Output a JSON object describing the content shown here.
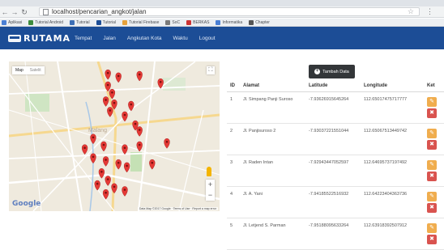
{
  "browser": {
    "url": "localhost/pencarian_angkot/jalan",
    "bookmarks": [
      {
        "label": "Aplikasi",
        "color": "#4a7fd4"
      },
      {
        "label": "Tutorial Android",
        "color": "#3d8b3d"
      },
      {
        "label": "Tutorial",
        "color": "#3d6fb6"
      },
      {
        "label": "Tutorial",
        "color": "#1c4d96"
      },
      {
        "label": "Tutorial Firebase",
        "color": "#e6a23c"
      },
      {
        "label": "SoC",
        "color": "#7a7a7a"
      },
      {
        "label": "BERKAS",
        "color": "#cc3333"
      },
      {
        "label": "Informatika",
        "color": "#4a7fd4"
      },
      {
        "label": "Chapter",
        "color": "#555555"
      }
    ]
  },
  "navbar": {
    "brand": "RUTAMA",
    "items": [
      "Tempat",
      "Jalan",
      "Angkutan Kota",
      "Waktu",
      "Logout"
    ]
  },
  "map": {
    "type_active": "Map",
    "type_inactive": "Satelit",
    "google": "Google",
    "attribution": "Data Map ©2017 Google · Terms of Use · Report a map error",
    "city": "Malang",
    "zoom_in": "+",
    "zoom_out": "−",
    "markers": [
      [
        0.47,
        0.12
      ],
      [
        0.52,
        0.14
      ],
      [
        0.62,
        0.13
      ],
      [
        0.72,
        0.18
      ],
      [
        0.47,
        0.2
      ],
      [
        0.49,
        0.25
      ],
      [
        0.46,
        0.3
      ],
      [
        0.5,
        0.32
      ],
      [
        0.48,
        0.37
      ],
      [
        0.58,
        0.33
      ],
      [
        0.55,
        0.4
      ],
      [
        0.6,
        0.46
      ],
      [
        0.62,
        0.5
      ],
      [
        0.4,
        0.55
      ],
      [
        0.36,
        0.62
      ],
      [
        0.45,
        0.6
      ],
      [
        0.55,
        0.62
      ],
      [
        0.62,
        0.6
      ],
      [
        0.75,
        0.58
      ],
      [
        0.4,
        0.68
      ],
      [
        0.46,
        0.7
      ],
      [
        0.52,
        0.72
      ],
      [
        0.56,
        0.74
      ],
      [
        0.68,
        0.72
      ],
      [
        0.44,
        0.78
      ],
      [
        0.47,
        0.83
      ],
      [
        0.42,
        0.86
      ],
      [
        0.5,
        0.88
      ],
      [
        0.46,
        0.92
      ],
      [
        0.55,
        0.9
      ]
    ]
  },
  "panel": {
    "add_button": "Tambah Data",
    "headers": [
      "ID",
      "Alamat",
      "Latitude",
      "Longitude",
      "Ket"
    ],
    "rows": [
      {
        "id": "1",
        "alamat": "Jl. Simpang Panji Suroso",
        "lat": "-7.93626915645264",
        "lng": "112.65017475717777"
      },
      {
        "id": "2",
        "alamat": "Jl. Panjisuroso 2",
        "lat": "-7.93037221551044",
        "lng": "112.65067513449742"
      },
      {
        "id": "3",
        "alamat": "Jl. Raden Intan",
        "lat": "-7.92943447052597",
        "lng": "112.64695737197492"
      },
      {
        "id": "4",
        "alamat": "Jl. A. Yani",
        "lat": "-7.94185522516932",
        "lng": "112.64223404363736"
      },
      {
        "id": "5",
        "alamat": "Jl. Letjend S. Parman",
        "lat": "-7.95188095633264",
        "lng": "112.63918392507912"
      }
    ]
  }
}
